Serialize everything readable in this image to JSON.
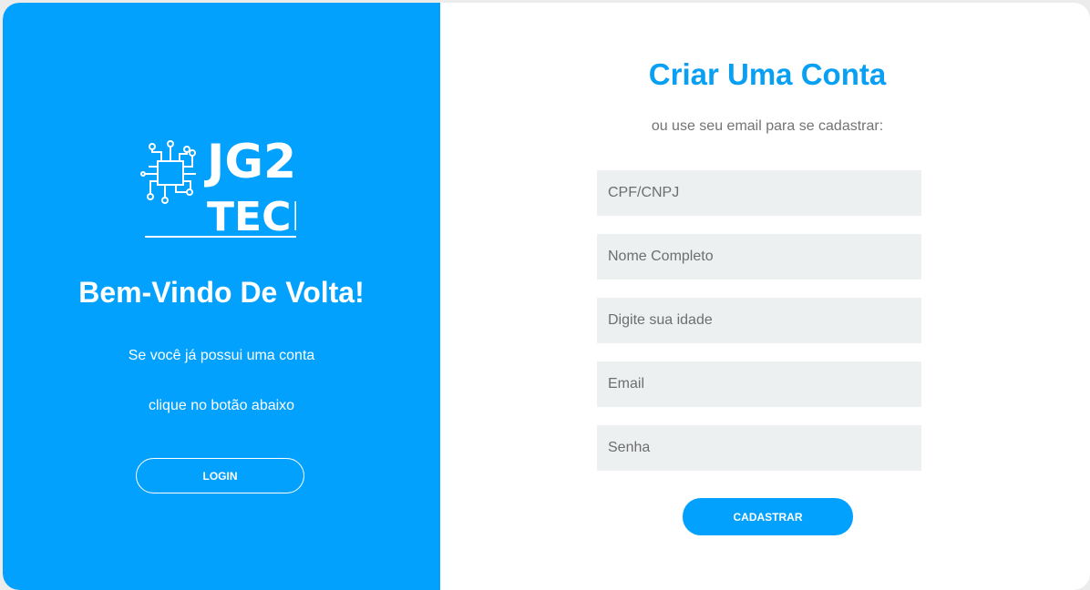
{
  "left": {
    "logo": {
      "line1": "JG2",
      "line2": "TECH",
      "icon": "circuit-chip-icon"
    },
    "title": "Bem-Vindo De Volta!",
    "text_line1": "Se você já possui uma conta",
    "text_line2": "clique no botão abaixo",
    "login_label": "LOGIN"
  },
  "right": {
    "title": "Criar Uma Conta",
    "subtitle": "ou use seu email para se cadastrar:",
    "fields": [
      {
        "placeholder": "CPF/CNPJ",
        "value": ""
      },
      {
        "placeholder": "Nome Completo",
        "value": ""
      },
      {
        "placeholder": "Digite sua idade",
        "value": ""
      },
      {
        "placeholder": "Email",
        "value": ""
      },
      {
        "placeholder": "Senha",
        "value": ""
      }
    ],
    "submit_label": "CADASTRAR"
  },
  "colors": {
    "accent": "#03a1fe",
    "title_blue": "#09a0f3",
    "field_bg": "#ecf0f1",
    "subtitle_gray": "#737373"
  }
}
